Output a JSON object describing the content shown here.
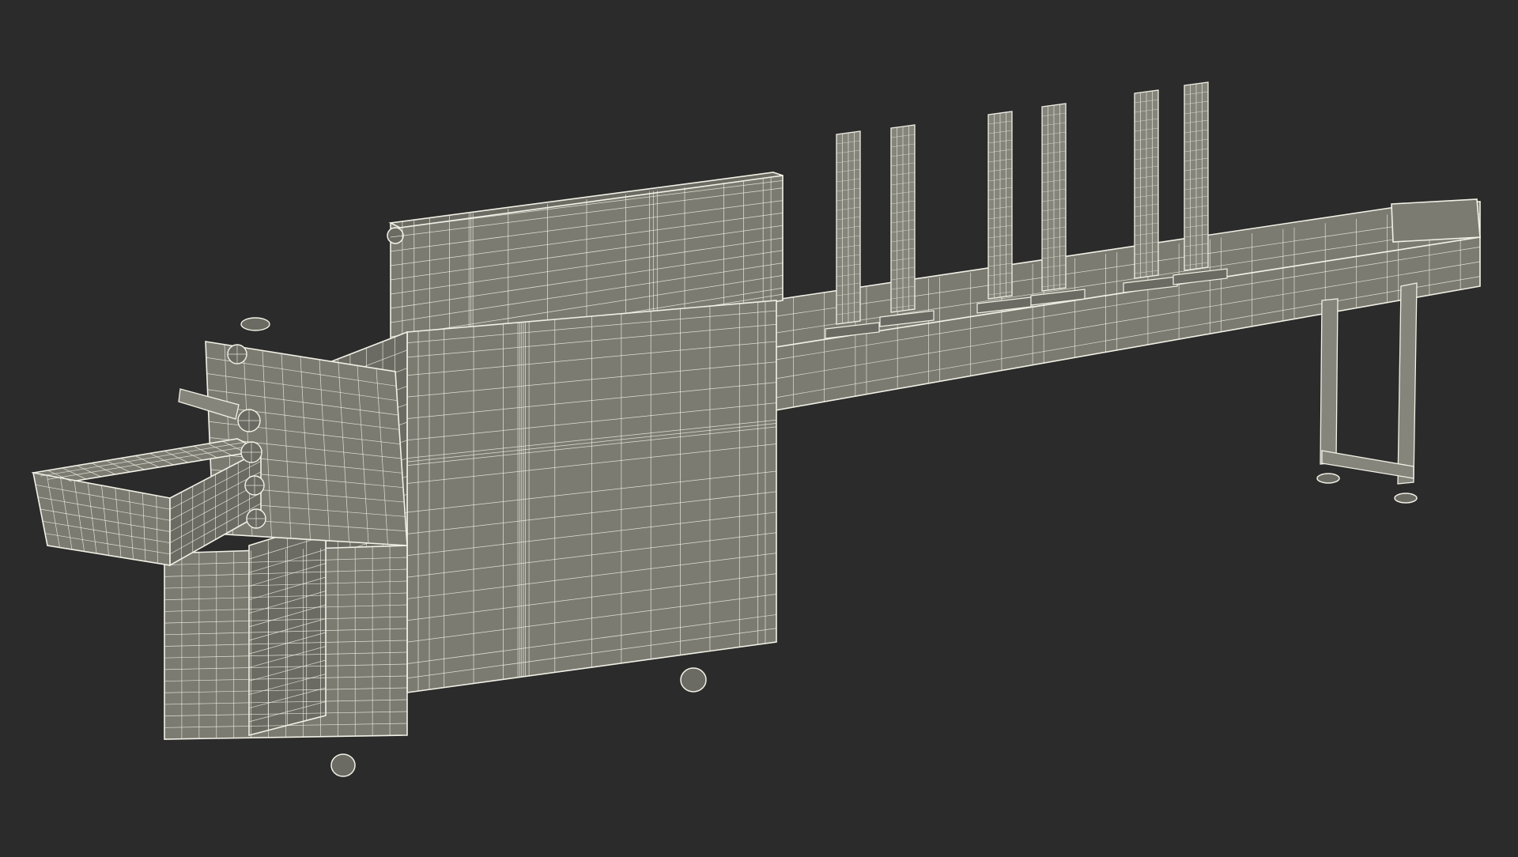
{
  "scene": {
    "background": "#2b2b2b",
    "body_fill": "#7b7b72",
    "body_fill_light": "#85857c",
    "body_fill_dark": "#6b6b63",
    "wire_color": "#f2f1e6",
    "wire_faint": "#dcdbcf"
  }
}
